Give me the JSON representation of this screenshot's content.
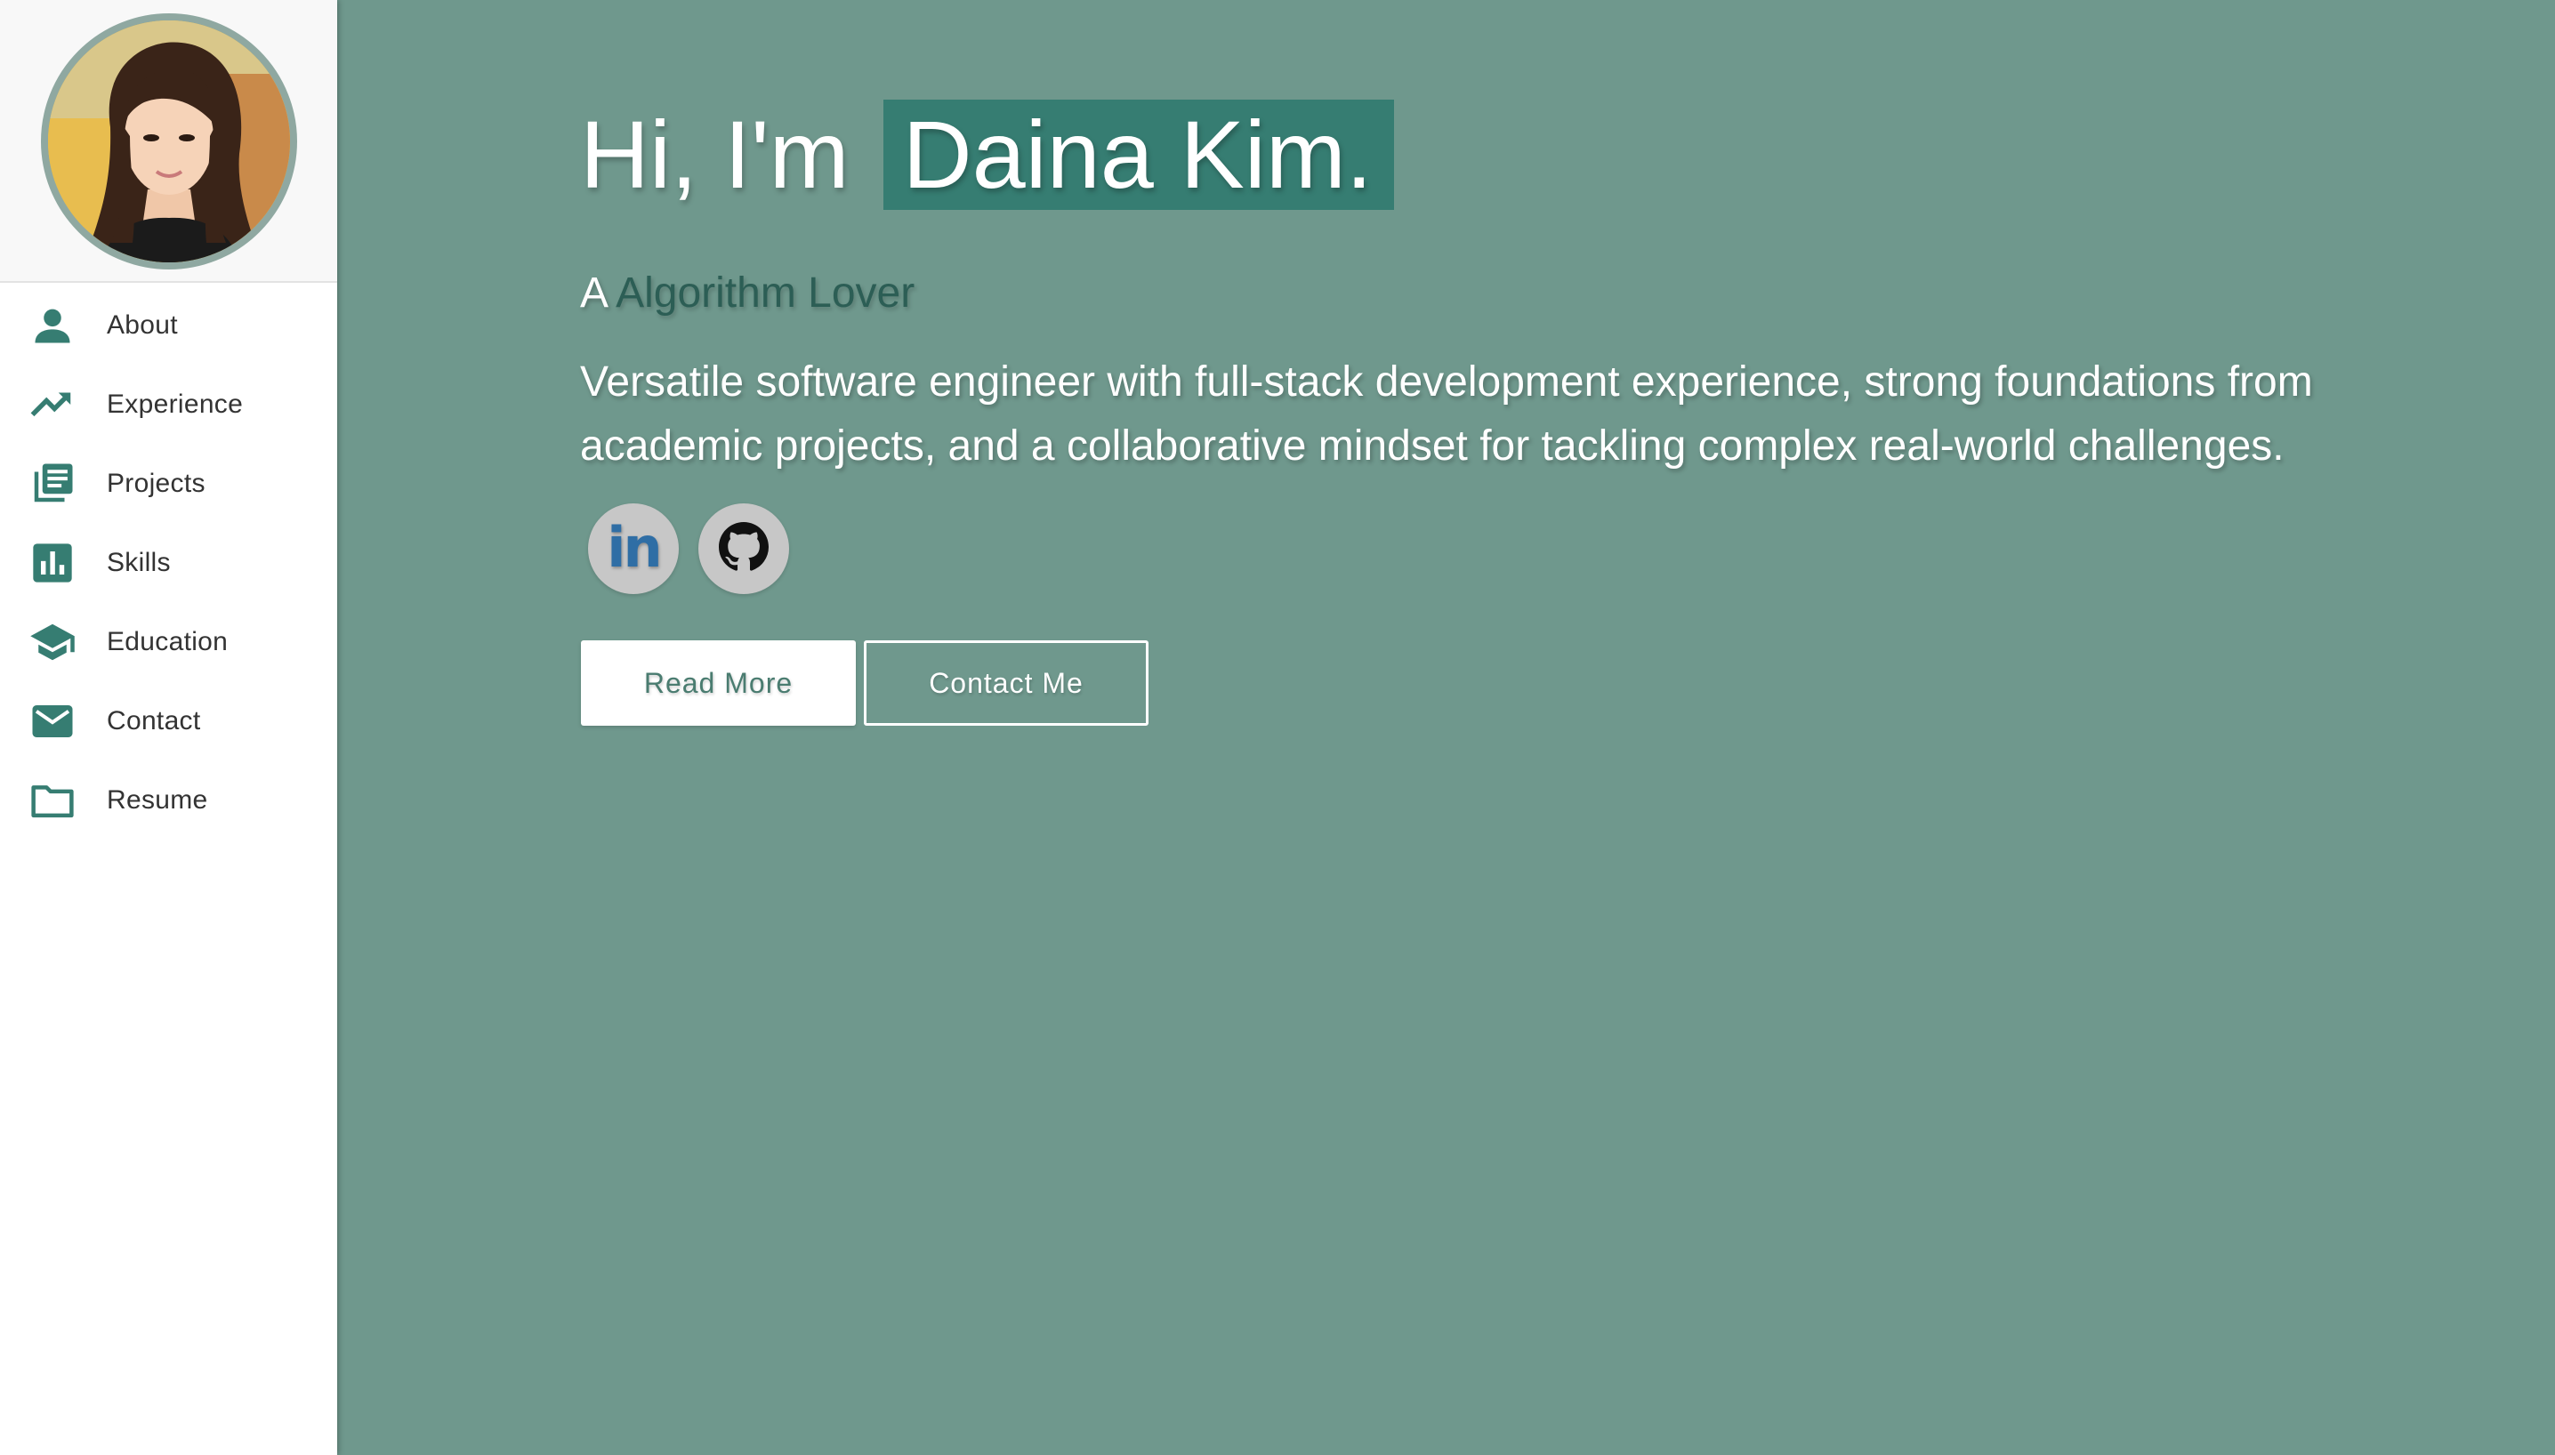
{
  "sidebar": {
    "profile_photo": "profile-photo",
    "items": [
      {
        "label": "About",
        "icon": "person-icon"
      },
      {
        "label": "Experience",
        "icon": "trending-up-icon"
      },
      {
        "label": "Projects",
        "icon": "library-books-icon"
      },
      {
        "label": "Skills",
        "icon": "bar-chart-icon"
      },
      {
        "label": "Education",
        "icon": "graduation-cap-icon"
      },
      {
        "label": "Contact",
        "icon": "mail-icon"
      },
      {
        "label": "Resume",
        "icon": "folder-icon"
      }
    ]
  },
  "hero": {
    "greeting": "Hi, I'm",
    "name": "Daina Kim.",
    "subtitle_prefix": "A",
    "subtitle_role": "Algorithm Lover",
    "description": "Versatile software engineer with full-stack development experience, strong foundations from academic projects, and a collaborative mindset for tackling complex real-world challenges.",
    "social": [
      {
        "name": "linkedin-icon",
        "text": "in"
      },
      {
        "name": "github-icon"
      }
    ],
    "buttons": {
      "read_more": "Read More",
      "contact_me": "Contact Me"
    }
  },
  "colors": {
    "background": "#6f988d",
    "accent": "#367d72",
    "sidebar_icon": "#367d72"
  }
}
